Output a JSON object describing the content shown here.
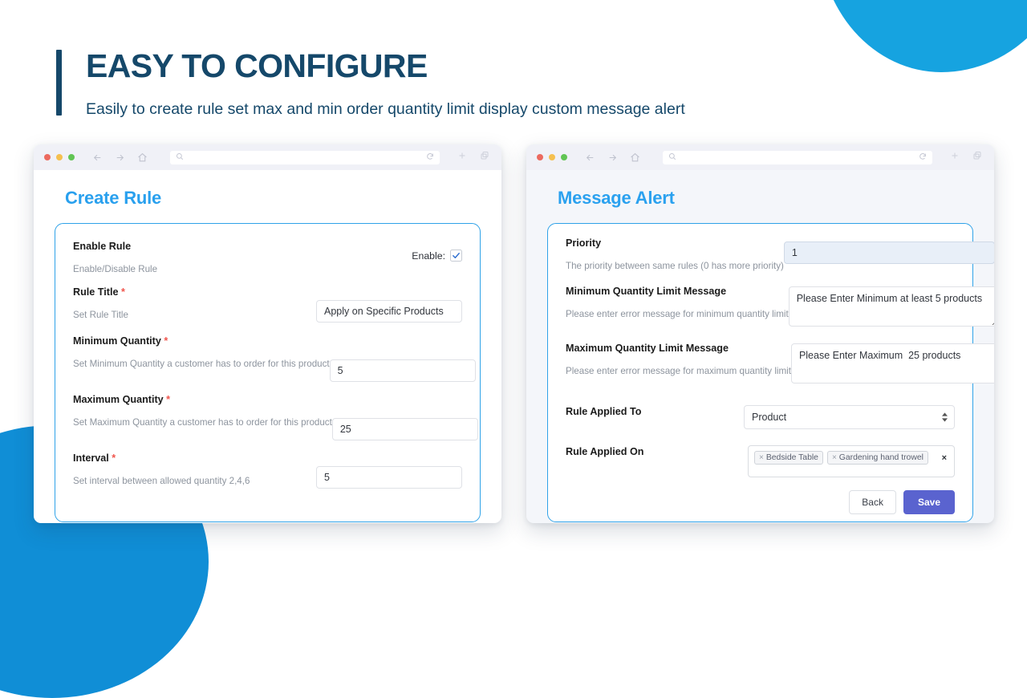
{
  "headline": {
    "title": "EASY TO CONFIGURE",
    "subtitle": "Easily to create rule set max and min order quantity limit display custom message alert"
  },
  "colors": {
    "heading_navy": "#15486a",
    "window_title_blue": "#2aa1ef",
    "card_border_blue": "#2fa2e8",
    "required_red": "#f0554d",
    "save_purple": "#5a63cf",
    "blob_cyan": "#16a3e0",
    "blob_blue": "#108ed6",
    "highlight_field": "#e8eff8"
  },
  "browser_chrome": {
    "search_value": "",
    "icons": {
      "back": "back-arrow-icon",
      "forward": "forward-arrow-icon",
      "home": "home-icon",
      "search": "search-icon",
      "reload": "reload-icon",
      "new_tab": "plus-icon",
      "tabs": "copy-tabs-icon"
    }
  },
  "left_window": {
    "title": "Create Rule",
    "fields": [
      {
        "label": "Enable Rule",
        "required": false,
        "hint": "Enable/Disable Rule",
        "type": "checkbox",
        "checkbox_label": "Enable:",
        "checked": true
      },
      {
        "label": "Rule Title",
        "required": true,
        "hint": "Set Rule Title",
        "type": "text",
        "value": "Apply on Specific Products"
      },
      {
        "label": "Minimum Quantity",
        "required": true,
        "hint": "Set Minimum Quantity a customer has to order for this product",
        "type": "text",
        "value": "5"
      },
      {
        "label": "Maximum Quantity",
        "required": true,
        "hint": "Set Maximum Quantity a customer has to order for this product",
        "type": "text",
        "value": "25"
      },
      {
        "label": "Interval",
        "required": true,
        "hint": "Set interval between allowed quantity 2,4,6",
        "type": "text",
        "value": "5"
      }
    ]
  },
  "right_window": {
    "title": "Message Alert",
    "fields": [
      {
        "label": "Priority",
        "required": false,
        "hint": "The priority between same rules (0 has more priority)",
        "type": "text",
        "value": "1",
        "highlighted": true
      },
      {
        "label": "Minimum Quantity Limit Message",
        "required": false,
        "hint": "Please enter error message for minimum quantity limit",
        "type": "textarea",
        "value": "Please Enter Minimum at least 5 products"
      },
      {
        "label": "Maximum Quantity Limit Message",
        "required": false,
        "hint": "Please enter error message for maximum quantity limit",
        "type": "textarea",
        "value": "Please Enter Maximum  25 products"
      },
      {
        "label": "Rule Applied To",
        "required": false,
        "hint": "",
        "type": "select",
        "value": "Product"
      },
      {
        "label": "Rule Applied On",
        "required": false,
        "hint": "",
        "type": "tags",
        "tags": [
          "Bedside Table",
          "Gardening hand trowel"
        ],
        "clear_symbol": "×"
      }
    ],
    "buttons": {
      "back": "Back",
      "save": "Save"
    }
  }
}
